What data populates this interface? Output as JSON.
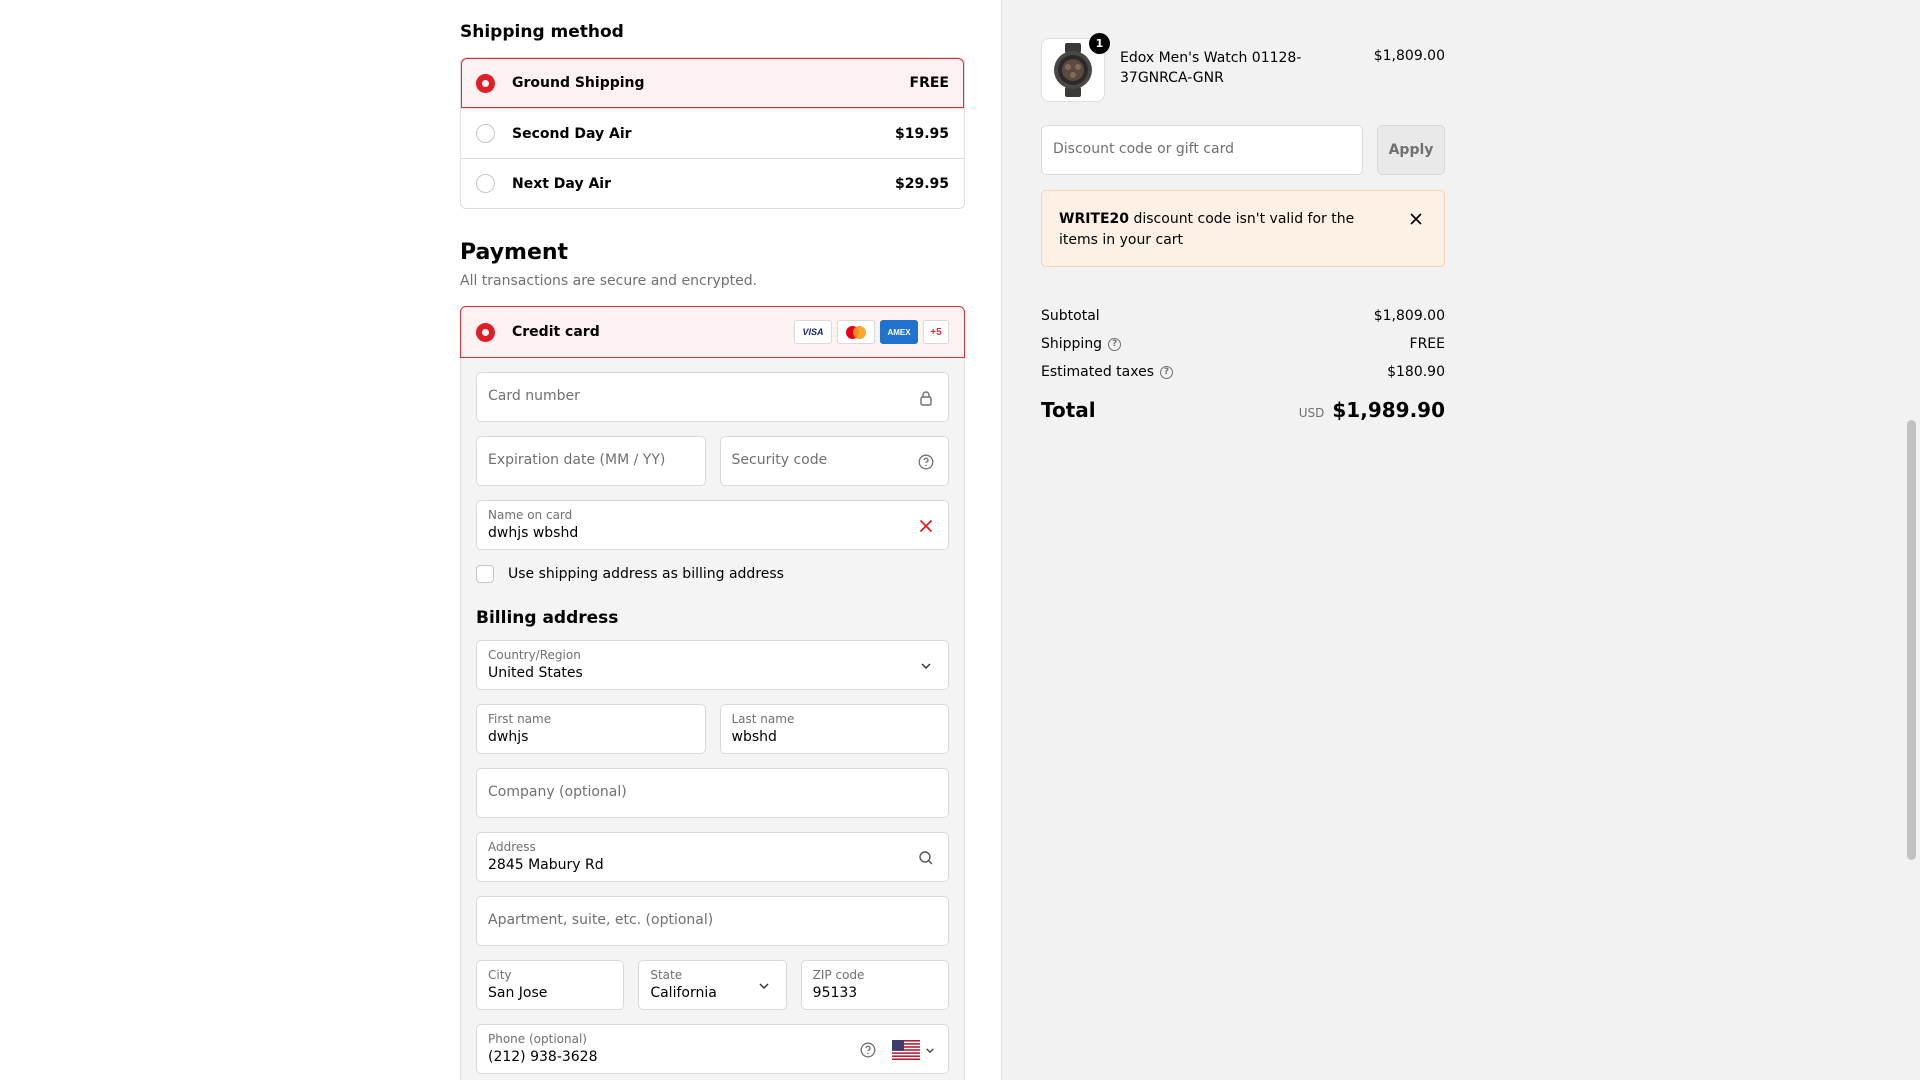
{
  "shipping": {
    "title": "Shipping method",
    "options": [
      {
        "label": "Ground Shipping",
        "price": "FREE",
        "selected": true
      },
      {
        "label": "Second Day Air",
        "price": "$19.95",
        "selected": false
      },
      {
        "label": "Next Day Air",
        "price": "$29.95",
        "selected": false
      }
    ]
  },
  "payment": {
    "title": "Payment",
    "subtitle": "All transactions are secure and encrypted.",
    "method_label": "Credit card",
    "brands": [
      "VISA",
      "AMEX",
      "+5"
    ],
    "card_number_placeholder": "Card number",
    "expiration_placeholder": "Expiration date (MM / YY)",
    "security_placeholder": "Security code",
    "name_label": "Name on card",
    "name_value": "dwhjs wbshd",
    "use_shipping_label": "Use shipping address as billing address"
  },
  "billing": {
    "title": "Billing address",
    "country_label": "Country/Region",
    "country_value": "United States",
    "first_name_label": "First name",
    "first_name_value": "dwhjs",
    "last_name_label": "Last name",
    "last_name_value": "wbshd",
    "company_placeholder": "Company (optional)",
    "address_label": "Address",
    "address_value": "2845 Mabury Rd",
    "apartment_placeholder": "Apartment, suite, etc. (optional)",
    "city_label": "City",
    "city_value": "San Jose",
    "state_label": "State",
    "state_value": "California",
    "zip_label": "ZIP code",
    "zip_value": "95133",
    "phone_label": "Phone (optional)",
    "phone_value": "(212) 938-3628"
  },
  "summary": {
    "product_name": "Edox Men's Watch 01128-37GNRCA-GNR",
    "product_qty": "1",
    "product_price": "$1,809.00",
    "discount_placeholder": "Discount code or gift card",
    "apply_label": "Apply",
    "notice_code": "WRITE20",
    "notice_text": " discount code isn't valid for the items in your cart",
    "subtotal_label": "Subtotal",
    "subtotal_value": "$1,809.00",
    "shipping_label": "Shipping",
    "shipping_value": "FREE",
    "taxes_label": "Estimated taxes",
    "taxes_value": "$180.90",
    "total_label": "Total",
    "total_currency": "USD",
    "total_value": "$1,989.90"
  },
  "colors": {
    "accent": "#e21d26",
    "selected_bg": "#fdf2f2",
    "notice_bg": "#fdf1e6",
    "summary_bg": "#f2f2f2"
  },
  "icons": [
    "lock-icon",
    "help-icon",
    "clear-icon",
    "chevron-down-icon",
    "search-icon",
    "close-icon",
    "us-flag-icon",
    "info-icon"
  ]
}
